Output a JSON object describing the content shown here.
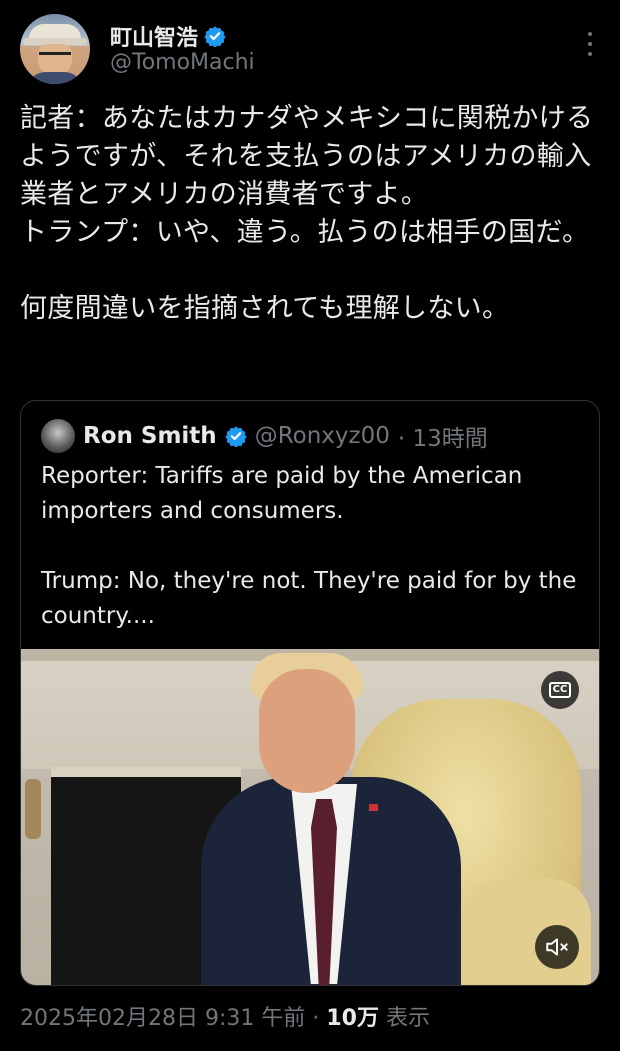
{
  "author": {
    "display_name": "町山智浩",
    "handle": "@TomoMachi",
    "verified_icon": "verified-badge-icon"
  },
  "post": {
    "text": "記者：あなたはカナダやメキシコに関税かけるようですが、それを支払うのはアメリカの輸入業者とアメリカの消費者ですよ。\nトランプ：いや、違う。払うのは相手の国だ。\n\n何度間違いを指摘されても理解しない。"
  },
  "quote": {
    "display_name": "Ron Smith",
    "handle": "@Ronxyz00",
    "time": "· 13時間",
    "text": "Reporter: Tariffs are paid by the American importers and consumers.\n\nTrump: No, they're not. They're paid for by the country....",
    "cc_label": "CC"
  },
  "meta": {
    "timestamp": "2025年02月28日 9:31 午前 · ",
    "views_count": "10万",
    "views_label": " 表示"
  },
  "colors": {
    "background": "#000000",
    "text": "#e7e9ea",
    "muted": "#71767b",
    "verified": "#1d9bf0",
    "border": "#2f3336"
  }
}
